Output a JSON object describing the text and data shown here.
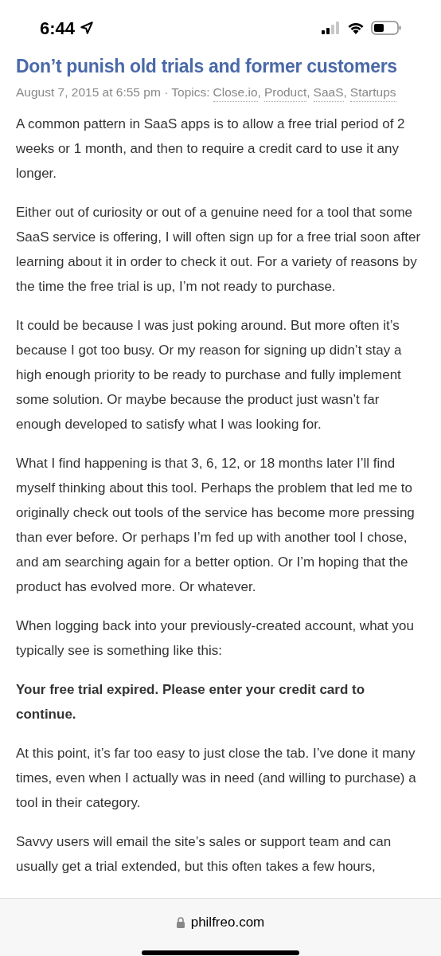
{
  "status_bar": {
    "time": "6:44"
  },
  "post": {
    "title": "Don’t punish old trials and former customers",
    "meta": {
      "date": "August 7, 2015 at 6:55 pm · Topics:",
      "topics": [
        {
          "label": "Close.io",
          "separator": ","
        },
        {
          "label": "Product",
          "separator": ","
        },
        {
          "label": "SaaS",
          "separator": ","
        },
        {
          "label": "Startups"
        }
      ]
    },
    "paragraphs": [
      {
        "kind": "text",
        "text": "A common pattern in SaaS apps is to allow a free trial period of 2 weeks or 1 month, and then to require a credit card to use it any longer."
      },
      {
        "kind": "text",
        "text": "Either out of curiosity or out of a genuine need for a tool that some SaaS service is offering, I will often sign up for a free trial soon after learning about it in order to check it out. For a variety of reasons by the time the free trial is up, I’m not ready to purchase."
      },
      {
        "kind": "text",
        "text": "It could be because I was just poking around. But more often it’s because I got too busy. Or my reason for signing up didn’t stay a high enough priority to be ready to purchase and fully implement some solution. Or maybe because the product just wasn’t far enough developed to satisfy what I was looking for."
      },
      {
        "kind": "text",
        "text": "What I find happening is that 3, 6, 12, or 18 months later I’ll find myself thinking about this tool. Perhaps the problem that led me to originally check out tools of the service has become more pressing than ever before. Or perhaps I’m fed up with another tool I chose, and am searching again for a better option. Or I’m hoping that the product has evolved more. Or whatever."
      },
      {
        "kind": "text",
        "text": "When logging back into your previously-created account, what you typically see is something like this:"
      },
      {
        "kind": "bold",
        "text": "Your free trial expired. Please enter your credit card to continue."
      },
      {
        "kind": "text",
        "text": "At this point, it’s far too easy to just close the tab. I’ve done it many times, even when I actually was in need (and willing to purchase) a tool in their category."
      },
      {
        "kind": "text",
        "text": "Savvy users will email the site’s sales or support team and can usually get a trial extended, but this often takes a few hours,"
      }
    ]
  },
  "address_bar": {
    "domain": "philfreo.com"
  }
}
